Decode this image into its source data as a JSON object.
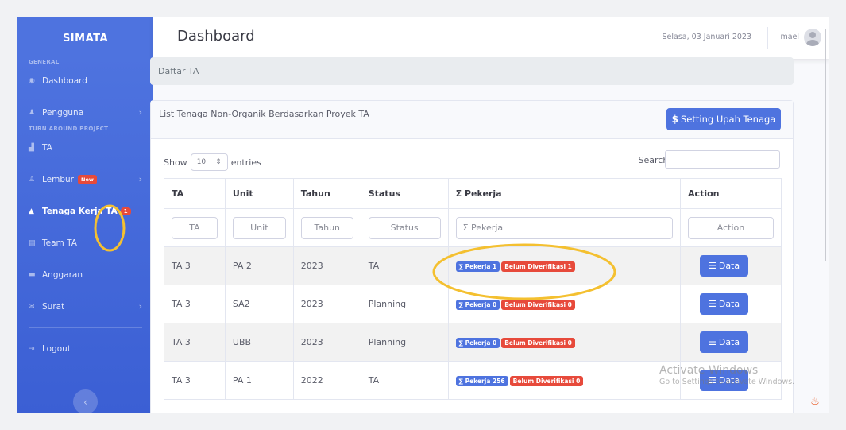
{
  "sidebar": {
    "brand": "SIMATA",
    "heading_general": "GENERAL",
    "heading_project": "TURN AROUND PROJECT",
    "items": [
      {
        "label": "Dashboard",
        "icon": "tachometer-icon"
      },
      {
        "label": "Pengguna",
        "icon": "users-icon"
      },
      {
        "label": "TA",
        "icon": "chart-area-icon"
      },
      {
        "label": "Lembur",
        "icon": "user-clock-icon",
        "badge": "New"
      },
      {
        "label": "Tenaga Kerja TA",
        "icon": "hard-hat-icon",
        "badge": "1"
      },
      {
        "label": "Team TA",
        "icon": "id-card-icon"
      },
      {
        "label": "Anggaran",
        "icon": "money-icon"
      },
      {
        "label": "Surat",
        "icon": "envelope-icon"
      },
      {
        "label": "Logout",
        "icon": "sign-out-icon"
      }
    ]
  },
  "topbar": {
    "title": "Dashboard",
    "date": "Selasa, 03 Januari 2023",
    "user": "mael"
  },
  "breadcrumb": "Daftar TA",
  "card": {
    "title": "List Tenaga Non-Organik Berdasarkan Proyek TA",
    "setting_button": "Setting Upah Tenaga",
    "show_label": "Show",
    "entries_value": "10",
    "entries_label": "entries",
    "search_label": "Search:"
  },
  "table": {
    "headers": [
      "TA",
      "Unit",
      "Tahun",
      "Status",
      "Σ Pekerja",
      "Action"
    ],
    "filters": [
      "TA",
      "Unit",
      "Tahun",
      "Status",
      "Σ Pekerja",
      "Action"
    ],
    "rows": [
      {
        "ta": "TA 3",
        "unit": "PA 2",
        "tahun": "2023",
        "status": "TA",
        "pekerja": "∑ Pekerja 1",
        "belum": "Belum Diverifikasi 1",
        "action": "Data"
      },
      {
        "ta": "TA 3",
        "unit": "SA2",
        "tahun": "2023",
        "status": "Planning",
        "pekerja": "∑ Pekerja 0",
        "belum": "Belum Diverifikasi 0",
        "action": "Data"
      },
      {
        "ta": "TA 3",
        "unit": "UBB",
        "tahun": "2023",
        "status": "Planning",
        "pekerja": "∑ Pekerja 0",
        "belum": "Belum Diverifikasi 0",
        "action": "Data"
      },
      {
        "ta": "TA 3",
        "unit": "PA 1",
        "tahun": "2022",
        "status": "TA",
        "pekerja": "∑ Pekerja 256",
        "belum": "Belum Diverifikasi 0",
        "action": "Data"
      }
    ]
  },
  "watermark": {
    "line1": "Activate Windows",
    "line2": "Go to Settings to activate Windows."
  },
  "colors": {
    "primary": "#4e73df",
    "danger": "#e74a3b",
    "annotation": "#f4c030"
  }
}
